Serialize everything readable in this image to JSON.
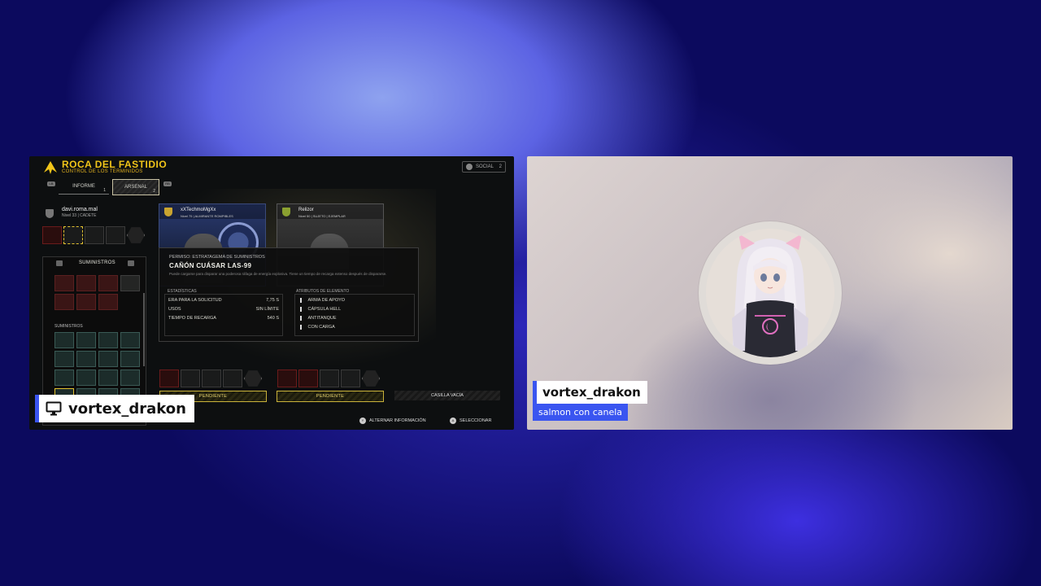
{
  "game": {
    "title": "ROCA DEL FASTIDIO",
    "subtitle": "CONTROL DE LOS TERMINIDOS",
    "tabs": [
      {
        "label": "INFORME",
        "num": "1"
      },
      {
        "label": "ARSENAL",
        "num": "2"
      }
    ],
    "social": {
      "label": "SOCIAL",
      "count": "2"
    },
    "local_player": {
      "name": "davi.roma.mal",
      "level": "Nivel 33 | CADETE"
    },
    "player2": {
      "name": "xXTechmoMgXx",
      "level": "Nivel 75 | ALMIRANTE ROMPIBLES"
    },
    "player3": {
      "name": "Relizor",
      "level": "Nivel 50 | SUJETO | EJEMPLAR"
    },
    "supplies_header": "SUMINISTROS",
    "supplies_sub": "SUMINISTROS",
    "tooltip": {
      "permission": "PERMISO: ESTRATAGEMA DE SUMINISTROS",
      "weapon_name": "CAÑÓN CUÁSAR LAS-99",
      "description": "Puede cargarse para disparar una poderosa ráfaga de energía explosiva. Tiene un tiempo de recarga extenso después de dispararse.",
      "stats_header": "ESTADÍSTICAS",
      "stats": [
        {
          "label": "ERA PARA LA SOLICITUD",
          "value": "7,75 S"
        },
        {
          "label": "USOS",
          "value": "SIN LÍMITE"
        },
        {
          "label": "TIEMPO DE RECARGA",
          "value": "540 S"
        }
      ],
      "attrs_header": "ATRIBUTOS DE ELEMENTO",
      "attrs": [
        "ARMA DE APOYO",
        "CÁPSULA HELL",
        "ANTITANQUE",
        "CON CARGA"
      ]
    },
    "pending_label": "PENDIENTE",
    "pending_label2": "PENDIENTE",
    "empty_label": "CASILLA VACÍA",
    "hints": [
      {
        "key": "Y",
        "label": "ALTERNAR INFORMACIÓN"
      },
      {
        "key": "A",
        "label": "SELECCIONAR"
      }
    ]
  },
  "left_tag": {
    "name": "vortex_drakon",
    "icon": "monitor-icon"
  },
  "right_tag": {
    "name": "vortex_drakon",
    "subtitle": "salmon con canela"
  },
  "colors": {
    "accent_blue": "#3a55f0",
    "game_gold": "#f0c419"
  }
}
